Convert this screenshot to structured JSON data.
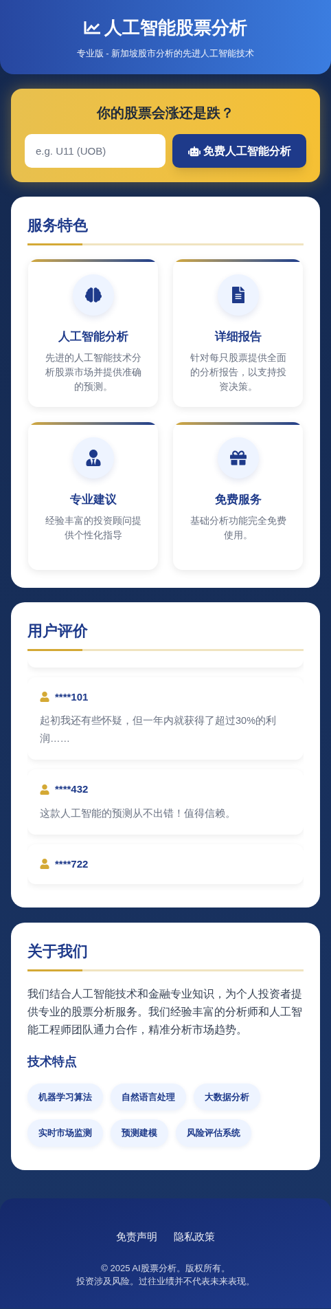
{
  "header": {
    "title": "人工智能股票分析",
    "subtitle": "专业版 - 新加坡股市分析的先进人工智能技术"
  },
  "query": {
    "title": "你的股票会涨还是跌？",
    "placeholder": "e.g. U11 (UOB)",
    "button": "免费人工智能分析"
  },
  "services": {
    "title": "服务特色",
    "items": [
      {
        "title": "人工智能分析",
        "text": "先进的人工智能技术分析股票市场并提供准确的预测。"
      },
      {
        "title": "详细报告",
        "text": "针对每只股票提供全面的分析报告，以支持投资决策。"
      },
      {
        "title": "专业建议",
        "text": "经验丰富的投资顾问提供个性化指导"
      },
      {
        "title": "免费服务",
        "text": "基础分析功能完全免费使用。"
      }
    ]
  },
  "reviews": {
    "title": "用户评价",
    "items": [
      {
        "user": "****101",
        "text": "起初我还有些怀疑，但一年内就获得了超过30%的利润……"
      },
      {
        "user": "****432",
        "text": "这款人工智能的预测从不出错！值得信赖。"
      },
      {
        "user": "****722"
      }
    ]
  },
  "about": {
    "title": "关于我们",
    "text": "我们结合人工智能技术和金融专业知识，为个人投资者提供专业的股票分析服务。我们经验丰富的分析师和人工智能工程师团队通力合作，精准分析市场趋势。",
    "subtitle": "技术特点",
    "tags": [
      "机器学习算法",
      "自然语言处理",
      "大数据分析",
      "实时市场监测",
      "预测建模",
      "风险评估系统"
    ]
  },
  "footer": {
    "links": [
      "免责声明",
      "隐私政策"
    ],
    "copyright": "© 2025 AI股票分析。版权所有。",
    "disclaimer": "投资涉及风险。过往业绩并不代表未来表现。"
  }
}
